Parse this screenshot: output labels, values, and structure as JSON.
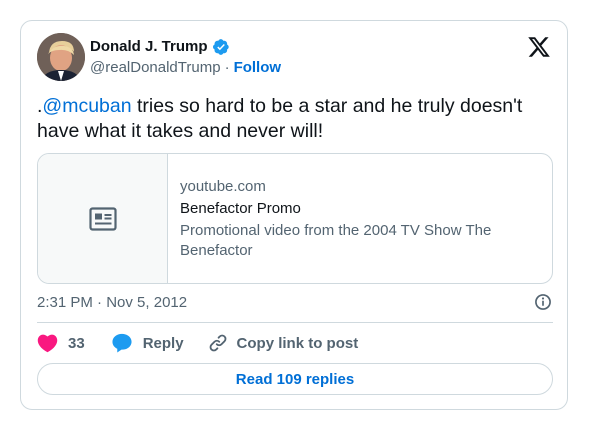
{
  "author": {
    "display_name": "Donald J. Trump",
    "handle": "@realDonaldTrump",
    "separator": "·",
    "follow_label": "Follow",
    "verified": true
  },
  "tweet": {
    "text_prefix": ".",
    "mention": "@mcuban",
    "text_rest": " tries so hard to be a star and he truly doesn't have what it takes and never will!"
  },
  "link_card": {
    "domain": "youtube.com",
    "title": "Benefactor Promo",
    "description": "Promotional video from the 2004 TV Show The Benefactor",
    "icon": "article-icon"
  },
  "meta": {
    "time": "2:31 PM",
    "separator": "·",
    "date": "Nov 5, 2012"
  },
  "actions": {
    "like_count": "33",
    "reply_label": "Reply",
    "copy_label": "Copy link to post"
  },
  "read_replies_label": "Read 109 replies",
  "colors": {
    "accent": "#006fd6",
    "like": "#f91880",
    "reply_icon": "#1d9bf0",
    "verified": "#1d9bf0",
    "secondary_text": "#536471",
    "border": "#cfd9de"
  }
}
